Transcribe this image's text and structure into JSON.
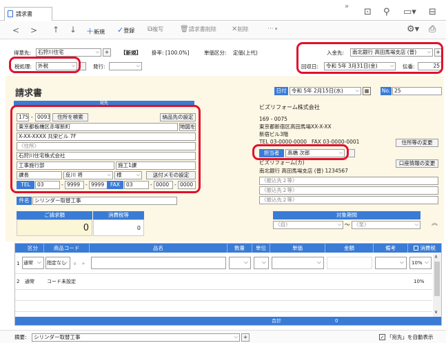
{
  "window": {
    "tab_title": "請求書"
  },
  "toolbar": {
    "back": "<",
    "forward": ">",
    "up": "↑",
    "down": "↓",
    "new_label": "新規",
    "register_label": "登録",
    "copy_label": "複写",
    "delete_invoice_label": "請求書削除",
    "delete_label": "削除",
    "more_label": "···"
  },
  "header": {
    "customer_label": "得意先:",
    "customer_value": "石狩川住宅",
    "status": "【新規】",
    "rate_label": "掛率:",
    "rate_value": "[100.0%]",
    "unit_label": "単価区分:",
    "unit_value": "定価(上代)",
    "tax_label": "税処理:",
    "tax_value": "外税",
    "issue_label": "発行:",
    "issue_value": "",
    "deposit_label": "入金先:",
    "deposit_value": "南北銀行 高田馬場支店 (普)",
    "collect_label": "回収日:",
    "collect_value": "令和 5年 3月31日(金)",
    "note_no_label": "伝番:",
    "note_no_value": "25"
  },
  "document": {
    "title": "請求書",
    "recipient_header": "宛先",
    "date_label": "日付",
    "date_value": "令和 5年 2月15日(水)",
    "no_label": "No.",
    "no_value": "25"
  },
  "address": {
    "zip1": "175",
    "zip2": "0093",
    "search_btn": "住所を検索",
    "delivery_btn": "納品先の設定",
    "addr1": "東京都板橋区赤塚新町",
    "map_btn": "地図を表示",
    "addr2": "X-XX-XXXX 共栄ビル 7F",
    "addr3_placeholder": "〈住所〉",
    "company": "石狩川住宅株式会社",
    "dept1": "工事施行部",
    "dept2": "施工1課",
    "title_value": "課長",
    "name_value": "反川 将",
    "honorific": "様",
    "memo_btn": "送付メモの設定",
    "tel_label": "TEL",
    "tel": [
      "03",
      "9999",
      "9999"
    ],
    "fax_label": "FAX",
    "fax": [
      "03",
      "0000",
      "0000"
    ]
  },
  "sender": {
    "company": "ビズリフォーム株式会社",
    "zip": "169 - 0075",
    "addr1": "東京都新宿区高田馬場XX-X-XX",
    "addr2": "新宿ビル3階",
    "tel": "TEL 03-0000-0000",
    "fax": "FAX 03-0000-0001",
    "address_change_btn": "住所等の変更",
    "rep_label": "担当者",
    "rep_value": "高橋 次郎",
    "bank_btn": "口座情報の変更",
    "payee": "ビズリフォーム(カ)",
    "bank_line": "南北銀行 高田馬場支店 (普) 1234567",
    "transfer_placeholders": [
      "〈振込先２等〉",
      "〈振込先２等〉",
      "〈振込先２等〉"
    ]
  },
  "subject": {
    "label": "件名",
    "value": "シリンダー取替工事"
  },
  "totals": {
    "invoice_label": "ご請求額",
    "tax_label": "消費税等",
    "invoice_value": "0",
    "tax_value": "0"
  },
  "period": {
    "label": "対象期間",
    "from": "〈自〉",
    "to": "〈至〉",
    "sep": "〜"
  },
  "table": {
    "headers": [
      "区分",
      "商品コード",
      "品名",
      "数量",
      "単位",
      "単価",
      "金額",
      "備考",
      "消費税"
    ],
    "rows": [
      {
        "no": "1",
        "kubun": "通常",
        "code": "指定なし",
        "tax": "10%"
      },
      {
        "no": "2",
        "kubun": "通常",
        "code": "コード未設定",
        "tax": "10%"
      }
    ],
    "total_label": "合計",
    "total_value": "0"
  },
  "footer": {
    "summary_label": "摘要:",
    "summary_value": "シリンダー取替工事",
    "auto_label": "「宛先」を自動表示"
  }
}
